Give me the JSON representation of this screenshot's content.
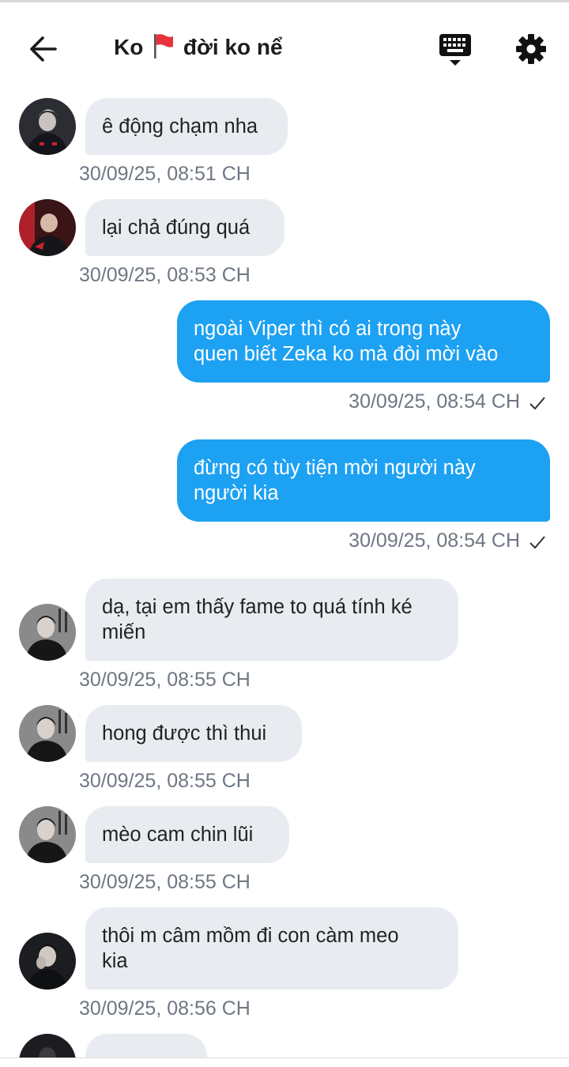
{
  "header": {
    "title_left": "Ko",
    "title_right": "đời ko nể",
    "flag_icon": "red-flag-icon",
    "back_icon": "arrow-left-icon",
    "keyboard_icon": "keyboard-icon",
    "settings_icon": "gear-icon"
  },
  "colors": {
    "outgoing_bubble": "#1da1f2",
    "incoming_bubble": "#e8ecf0",
    "timestamp": "#6e7783",
    "flag": "#e8323c"
  },
  "messages": [
    {
      "direction": "in",
      "line1": "ê động chạm nha",
      "line2": "",
      "time": "30/09/25, 08:51 CH"
    },
    {
      "direction": "in",
      "line1": "lại chả đúng quá",
      "line2": "",
      "time": "30/09/25, 08:53 CH"
    },
    {
      "direction": "out",
      "line1": "ngoài Viper thì có ai trong này",
      "line2": "quen biết Zeka ko mà đòi mời vào",
      "time": "30/09/25, 08:54 CH",
      "status": "✓"
    },
    {
      "direction": "out",
      "line1": "đừng có tùy tiện mời người này",
      "line2": "người kia",
      "time": "30/09/25, 08:54 CH",
      "status": "✓"
    },
    {
      "direction": "in",
      "line1": "dạ, tại em thấy fame to quá tính ké",
      "line2": "miến",
      "time": "30/09/25, 08:55 CH"
    },
    {
      "direction": "in",
      "line1": "hong được thì thui",
      "line2": "",
      "time": "30/09/25, 08:55 CH"
    },
    {
      "direction": "in",
      "line1": "mèo cam chin lũi",
      "line2": "",
      "time": "30/09/25, 08:55 CH"
    },
    {
      "direction": "in",
      "line1": "thôi m câm mồm đi con càm meo",
      "line2": "kia",
      "time": "30/09/25, 08:56 CH"
    },
    {
      "direction": "in",
      "line1": "",
      "line2": "",
      "time": ""
    }
  ]
}
